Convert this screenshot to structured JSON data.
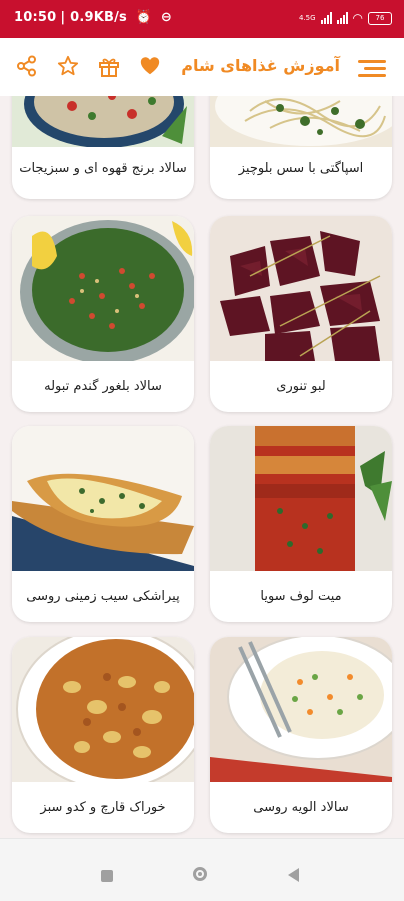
{
  "status_bar": {
    "time": "10:50",
    "network_speed": "0.9KB/s",
    "network_type": "4.5G",
    "battery": "76"
  },
  "app_bar": {
    "title": "آموزش غذاهای شام",
    "accent_color": "#f08a24"
  },
  "recipes": [
    {
      "name": "اسپاگتی با سس بلوچیز",
      "image": "spaghetti"
    },
    {
      "name": "سالاد برنج قهوه ای و سبزیجات",
      "image": "rice-salad"
    },
    {
      "name": "لبو تنوری",
      "image": "beet"
    },
    {
      "name": "سالاد بلغور گندم تبوله",
      "image": "tabbouleh"
    },
    {
      "name": "میت لوف سویا",
      "image": "meatloaf"
    },
    {
      "name": "پیراشکی سیب زمینی روسی",
      "image": "pirozhki"
    },
    {
      "name": "سالاد الویه روسی",
      "image": "olivier"
    },
    {
      "name": "خوراک قارچ و کدو سبز",
      "image": "mushroom-stew"
    }
  ],
  "nav_bar": {
    "buttons": [
      "recent-apps",
      "home",
      "back"
    ]
  }
}
